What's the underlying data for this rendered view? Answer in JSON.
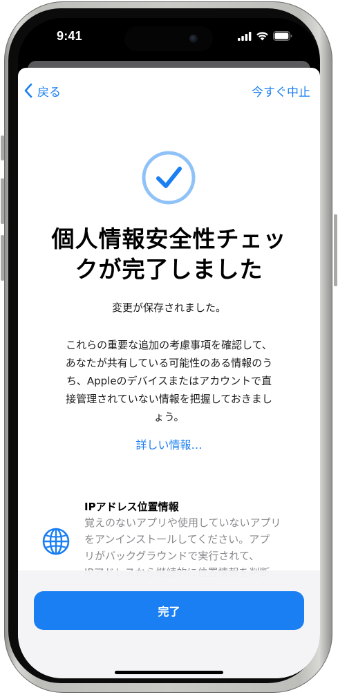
{
  "status_bar": {
    "time": "9:41"
  },
  "nav": {
    "back_label": "戻る",
    "cancel_label": "今すぐ中止"
  },
  "main": {
    "title_line1": "個人情報安全性チェッ",
    "title_line2": "クが完了しました",
    "saved_message": "変更が保存されました。",
    "body_lines": [
      "これらの重要な追加の考慮事項を確認して、",
      "あなたが共有している可能性のある情報のう",
      "ち、Appleのデバイスまたはアカウントで直",
      "接管理されていない情報を把握しておきまし",
      "ょう。"
    ],
    "more_link": "詳しい情報…"
  },
  "feature": {
    "icon": "globe-icon",
    "title": "IPアドレス位置情報",
    "desc_lines": [
      "覚えのないアプリや使用していないアプリ",
      "をアンインストールしてください。アプ",
      "リがバックグラウンドで実行されて、",
      "IPアドレスから継続的に位置情報を判断"
    ]
  },
  "footer": {
    "done_label": "完了"
  },
  "colors": {
    "accent": "#1a7ff2",
    "badge_ring": "#8fc2f7",
    "secondary_text": "#8a8a8e"
  }
}
